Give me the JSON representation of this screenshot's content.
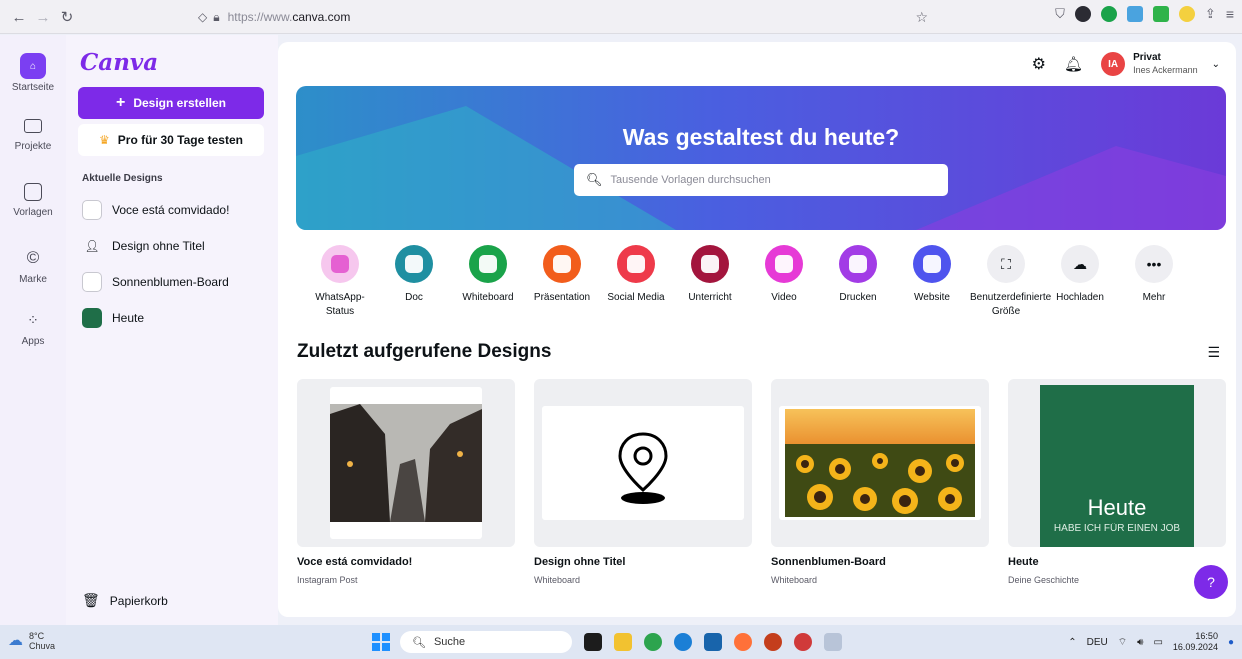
{
  "browser": {
    "url_prefix": "https://www.",
    "url_domain": "canva.com"
  },
  "rail": {
    "items": [
      {
        "label": "Startseite",
        "icon": "home-icon"
      },
      {
        "label": "Projekte",
        "icon": "folder-icon"
      },
      {
        "label": "Vorlagen",
        "icon": "template-icon"
      },
      {
        "label": "Marke",
        "icon": "brand-icon"
      },
      {
        "label": "Apps",
        "icon": "apps-icon"
      }
    ]
  },
  "panel": {
    "logo": "Canva",
    "create_label": "Design erstellen",
    "pro_label": "Pro für 30 Tage testen",
    "recent_heading": "Aktuelle Designs",
    "recent": [
      {
        "label": "Voce está comvidado!"
      },
      {
        "label": "Design ohne Titel"
      },
      {
        "label": "Sonnenblumen-Board"
      },
      {
        "label": "Heute"
      }
    ],
    "trash_label": "Papierkorb"
  },
  "header": {
    "account_type": "Privat",
    "account_name": "Ines Ackermann",
    "avatar_initials": "IA"
  },
  "hero": {
    "title": "Was gestaltest du heute?",
    "search_placeholder": "Tausende Vorlagen durchsuchen"
  },
  "quick_actions": [
    {
      "label": "WhatsApp-Status",
      "color": "#f6c7ee",
      "inner": "#e45bd0"
    },
    {
      "label": "Doc",
      "color": "#1f8fa1"
    },
    {
      "label": "Whiteboard",
      "color": "#1aa34a"
    },
    {
      "label": "Präsentation",
      "color": "#f25d1c"
    },
    {
      "label": "Social Media",
      "color": "#ee3a4a"
    },
    {
      "label": "Unterricht",
      "color": "#a3153d"
    },
    {
      "label": "Video",
      "color": "#e63ad6"
    },
    {
      "label": "Drucken",
      "color": "#a23ce6"
    },
    {
      "label": "Website",
      "color": "#4f54ee"
    },
    {
      "label": "Benutzerdefinierte Größe",
      "color": "#eeeef2"
    },
    {
      "label": "Hochladen",
      "color": "#eeeef2"
    },
    {
      "label": "Mehr",
      "color": "#eeeef2"
    }
  ],
  "recent_section": {
    "title": "Zuletzt aufgerufene Designs"
  },
  "cards": [
    {
      "title": "Voce está comvidado!",
      "subtitle": "Instagram Post"
    },
    {
      "title": "Design ohne Titel",
      "subtitle": "Whiteboard"
    },
    {
      "title": "Sonnenblumen-Board",
      "subtitle": "Whiteboard"
    },
    {
      "title": "Heute",
      "subtitle": "Deine Geschichte",
      "thumb_title": "Heute",
      "thumb_sub": "HABE ICH FÜR EINEN JOB"
    }
  ],
  "help_label": "?",
  "taskbar": {
    "temp": "8°C",
    "weather": "Chuva",
    "search_label": "Suche",
    "lang": "DEU",
    "time": "16:50",
    "date": "16.09.2024"
  },
  "colors": {
    "brand": "#7d2ae8",
    "avatar": "#e94444"
  }
}
